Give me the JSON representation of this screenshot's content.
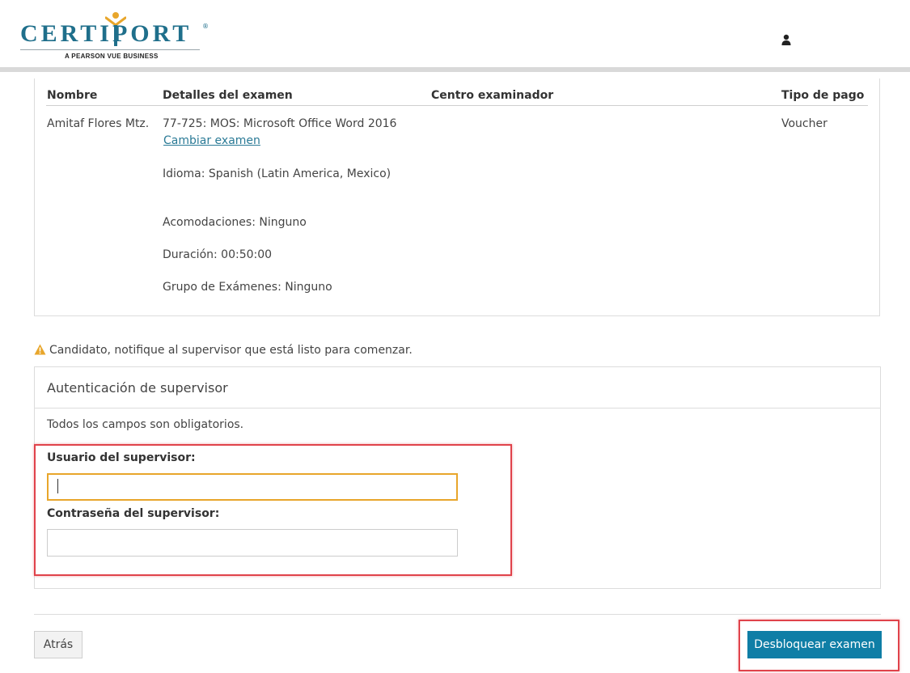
{
  "header": {
    "logo_text": "CERTIPORT",
    "logo_registered": "®",
    "logo_subtitle": "A PEARSON VUE BUSINESS",
    "user_icon": "user-icon"
  },
  "exam_table": {
    "headers": {
      "name": "Nombre",
      "details": "Detalles del examen",
      "center": "Centro examinador",
      "payment": "Tipo de pago"
    },
    "row": {
      "name": "Amitaf Flores Mtz.",
      "exam": "77-725: MOS: Microsoft Office Word 2016",
      "change_exam_link": "Cambiar examen",
      "language": "Idioma: Spanish (Latin America, Mexico)",
      "accommodations": "Acomodaciones: Ninguno",
      "duration": "Duración: 00:50:00",
      "exam_group": "Grupo de Exámenes: Ninguno",
      "payment": "Voucher"
    }
  },
  "warning": {
    "icon": "warning-icon",
    "color": "#e8a62b",
    "text": "Candidato, notifique al supervisor que está listo para comenzar."
  },
  "auth": {
    "title": "Autenticación de supervisor",
    "required_note": "Todos los campos son obligatorios.",
    "username_label": "Usuario del supervisor:",
    "username_value": "",
    "password_label": "Contraseña del supervisor:",
    "password_value": ""
  },
  "buttons": {
    "back": "Atrás",
    "unlock": "Desbloquear examen"
  },
  "colors": {
    "brand": "#1f6f8b",
    "primary_button": "#0f7ea6",
    "focus_border": "#e8a62b",
    "highlight": "#e0434b"
  }
}
